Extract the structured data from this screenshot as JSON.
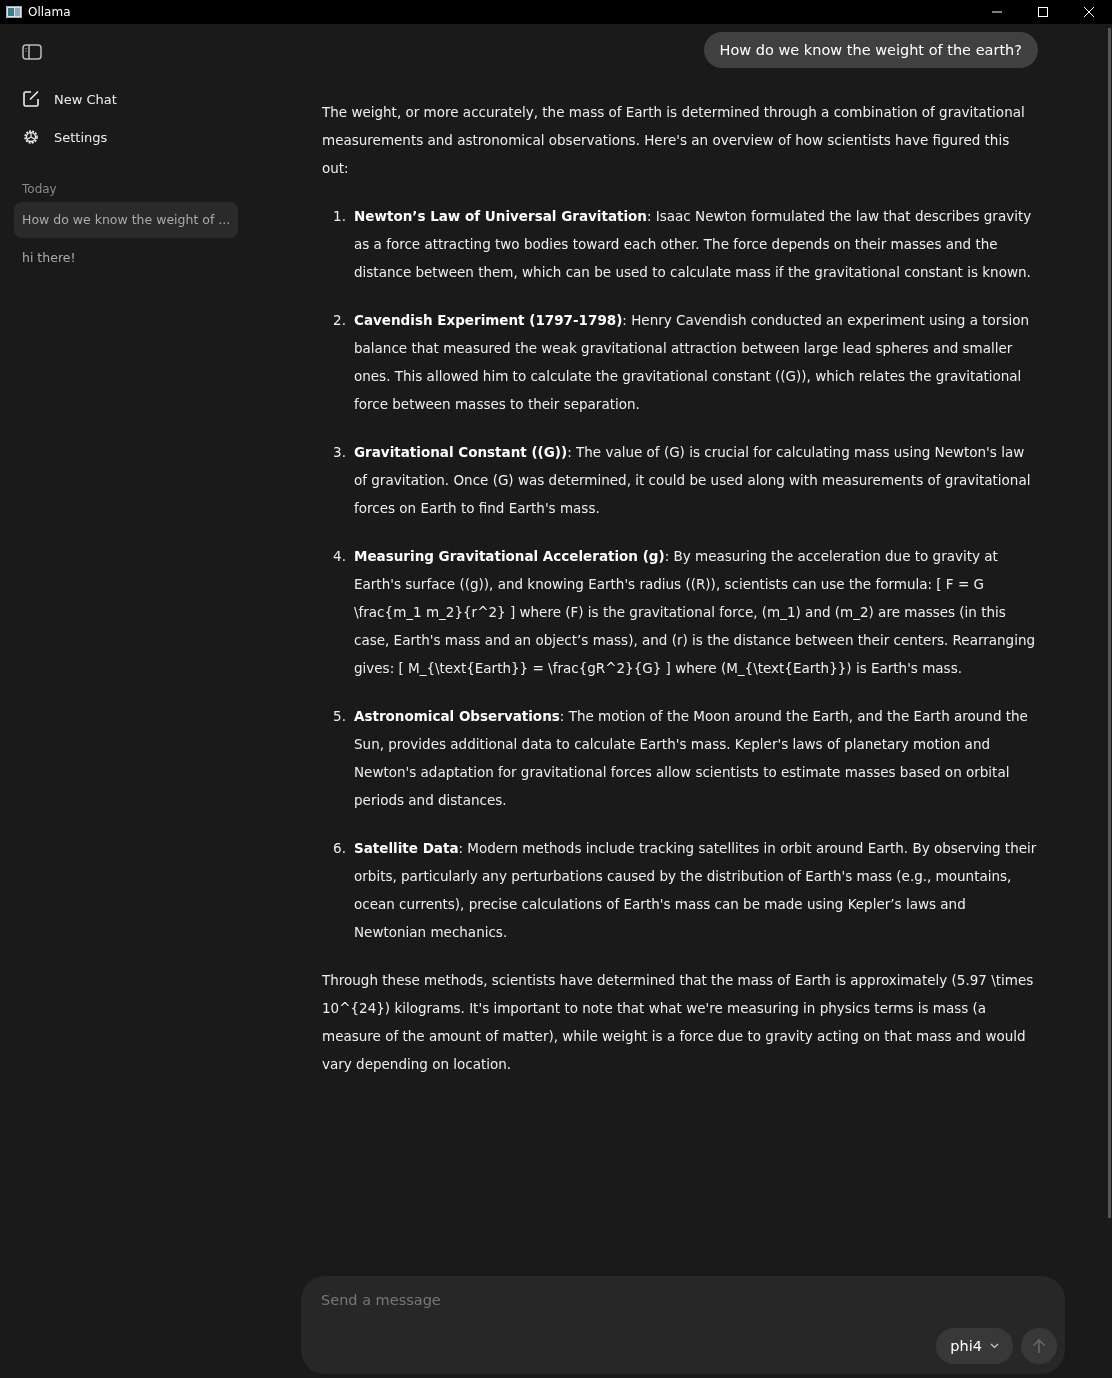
{
  "window": {
    "title": "Ollama"
  },
  "sidebar": {
    "actions": [
      {
        "kind": "new",
        "label": "New Chat"
      },
      {
        "kind": "settings",
        "label": "Settings"
      }
    ],
    "section": "Today",
    "chats": [
      {
        "title": "How do we know the weight of ...",
        "selected": true
      },
      {
        "title": "hi there!",
        "selected": false
      }
    ]
  },
  "user_message": "How do we know the weight of the earth?",
  "answer": {
    "intro": "The weight, or more accurately, the mass of Earth is determined through a combination of gravitational measurements and astronomical observations. Here's an overview of how scientists have figured this out:",
    "items": [
      {
        "number": "1.",
        "text": "**Newton’s Law of Universal Gravitation**: Isaac Newton formulated the law that describes gravity as a force attracting two bodies toward each other. The force depends on their masses and the distance between them, which can be used to calculate mass if the gravitational constant is known."
      },
      {
        "number": "2.",
        "text": "**Cavendish Experiment (1797-1798)**: Henry Cavendish conducted an experiment using a torsion balance that measured the weak gravitational attraction between large lead spheres and smaller ones. This allowed him to calculate the gravitational constant ((G)), which relates the gravitational force between masses to their separation."
      },
      {
        "number": "3.",
        "text": "**Gravitational Constant ((G))**: The value of (G) is crucial for calculating mass using Newton's law of gravitation. Once (G) was determined, it could be used along with measurements of gravitational forces on Earth to find Earth's mass."
      },
      {
        "number": "4.",
        "text": "**Measuring Gravitational Acceleration (g)**: By measuring the acceleration due to gravity at Earth's surface ((g)), and knowing Earth's radius ((R)), scientists can use the formula: [ F = G \\frac{m_1 m_2}{r^2} ] where (F) is the gravitational force, (m_1) and (m_2) are masses (in this case, Earth's mass and an object’s mass), and (r) is the distance between their centers. Rearranging gives: [ M_{\\text{Earth}} = \\frac{gR^2}{G} ] where (M_{\\text{Earth}}) is Earth's mass."
      },
      {
        "number": "5.",
        "text": "**Astronomical Observations**: The motion of the Moon around the Earth, and the Earth around the Sun, provides additional data to calculate Earth's mass. Kepler's laws of planetary motion and Newton's adaptation for gravitational forces allow scientists to estimate masses based on orbital periods and distances."
      },
      {
        "number": "6.",
        "text": "**Satellite Data**: Modern methods include tracking satellites in orbit around Earth. By observing their orbits, particularly any perturbations caused by the distribution of Earth's mass (e.g., mountains, ocean currents), precise calculations of Earth's mass can be made using Kepler’s laws and Newtonian mechanics."
      }
    ],
    "conclusion": "Through these methods, scientists have determined that the mass of Earth is approximately (5.97 \\times 10^{24}) kilograms. It's important to note that what we're measuring in physics terms is mass (a measure of the amount of matter), while weight is a force due to gravity acting on that mass and would vary depending on location."
  },
  "composer": {
    "placeholder": "Send a message",
    "model": "phi4"
  }
}
